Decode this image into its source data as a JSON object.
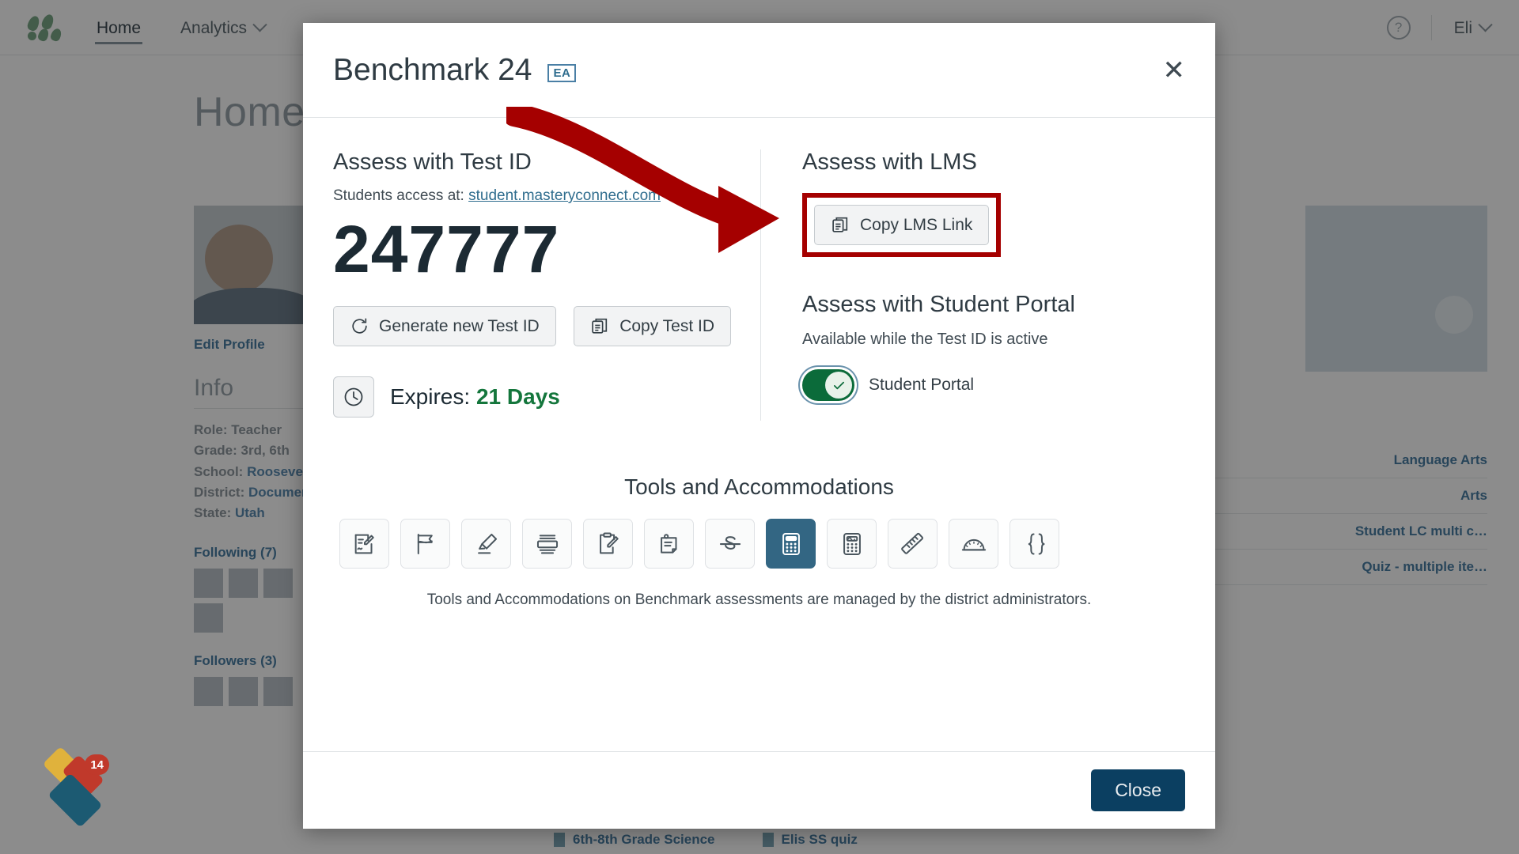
{
  "nav": {
    "logo_icon": "masteryconnect-logo-icon",
    "links": [
      {
        "label": "Home",
        "active": true
      },
      {
        "label": "Analytics",
        "active": false,
        "icon": "chevron-down-icon"
      }
    ],
    "help_icon": "question-mark-help-icon",
    "user": {
      "label": "Eli",
      "icon": "chevron-down-icon"
    }
  },
  "page": {
    "title": "Home",
    "profile": {
      "edit_link": "Edit Profile",
      "info_heading": "Info",
      "lines": [
        {
          "label": "Role:",
          "value": "Teacher",
          "link": false
        },
        {
          "label": "Grade:",
          "value": "3rd, 6th",
          "link": false
        },
        {
          "label": "School:",
          "value": "Roosevelt",
          "link": true
        },
        {
          "label": "District:",
          "value": "Documentation",
          "link": true
        },
        {
          "label": "State:",
          "value": "Utah",
          "link": true
        }
      ],
      "following": "Following (7)",
      "followers": "Followers (3)"
    },
    "right_items": [
      "Language Arts",
      "Arts",
      "Student LC multi c…",
      "Quiz - multiple ite…"
    ],
    "bottom_items": [
      "6th-8th Grade Science",
      "Elis SS quiz"
    ],
    "badge_count": "14"
  },
  "modal": {
    "title": "Benchmark 24",
    "title_badge": "EA",
    "close_icon": "close-x-icon",
    "test_id_section": {
      "heading": "Assess with Test ID",
      "access_prefix": "Students access at:",
      "access_link": "student.masteryconnect.com",
      "test_id": "247777",
      "generate_label": "Generate new Test ID",
      "generate_icon": "refresh-icon",
      "copy_label": "Copy Test ID",
      "copy_icon": "copy-icon",
      "expires_icon": "clock-icon",
      "expires_label": "Expires:",
      "expires_value": "21 Days",
      "expires_color": "#14763c"
    },
    "lms_section": {
      "heading": "Assess with LMS",
      "copy_lms_label": "Copy LMS Link",
      "copy_lms_icon": "copy-icon",
      "highlight_color": "#a50000"
    },
    "portal_section": {
      "heading": "Assess with Student Portal",
      "subtitle": "Available while the Test ID is active",
      "toggle_label": "Student Portal",
      "toggle_on": true,
      "toggle_color": "#0b6b3a",
      "toggle_icon": "check-icon"
    },
    "tools_section": {
      "heading": "Tools and Accommodations",
      "note": "Tools and Accommodations on Benchmark assessments are managed by the district administrators.",
      "items": [
        {
          "icon": "scratchpad-icon",
          "selected": false
        },
        {
          "icon": "flag-icon",
          "selected": false
        },
        {
          "icon": "highlighter-icon",
          "selected": false
        },
        {
          "icon": "line-reader-icon",
          "selected": false
        },
        {
          "icon": "clipboard-pencil-icon",
          "selected": false
        },
        {
          "icon": "notes-icon",
          "selected": false
        },
        {
          "icon": "strikethrough-icon",
          "selected": false
        },
        {
          "icon": "calculator-icon",
          "selected": true
        },
        {
          "icon": "graphing-calculator-icon",
          "selected": false
        },
        {
          "icon": "ruler-icon",
          "selected": false
        },
        {
          "icon": "protractor-icon",
          "selected": false
        },
        {
          "icon": "formula-brace-icon",
          "selected": false
        }
      ],
      "selected_color": "#336683"
    },
    "close_label": "Close"
  },
  "annotation": {
    "arrow_color": "#a50000",
    "arrow_icon": "pointer-arrow-icon"
  }
}
